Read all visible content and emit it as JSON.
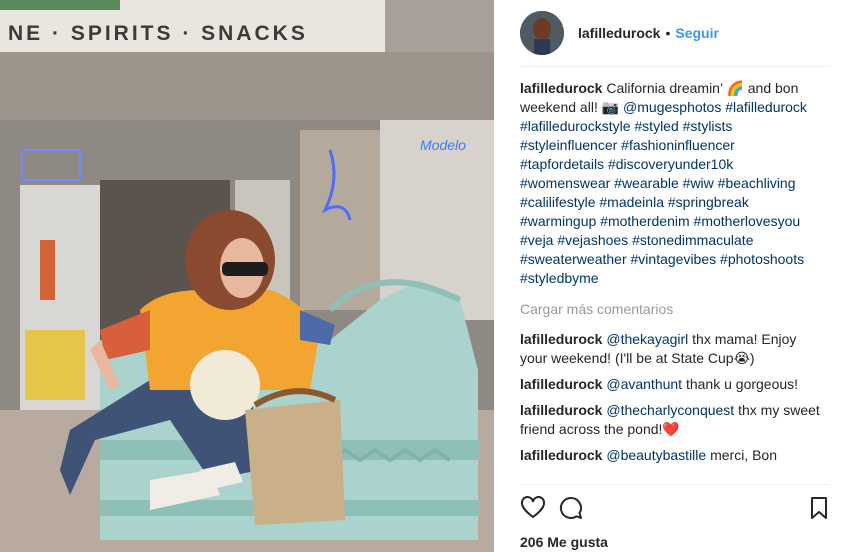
{
  "photo": {
    "sign_text": "NE · SPIRITS · SNACKS",
    "neon_text": "Modelo"
  },
  "header": {
    "username": "lafilledurock",
    "separator": "•",
    "follow_label": "Seguir"
  },
  "caption": {
    "username": "lafilledurock",
    "text_parts": [
      {
        "type": "text",
        "value": " California dreamin’ 🌈 and bon weekend all! 📷 "
      },
      {
        "type": "tag",
        "value": "@mugesphotos"
      },
      {
        "type": "text",
        "value": " "
      },
      {
        "type": "tag",
        "value": "#lafilledurock"
      },
      {
        "type": "text",
        "value": " "
      },
      {
        "type": "tag",
        "value": "#lafilledurockstyle"
      },
      {
        "type": "text",
        "value": " "
      },
      {
        "type": "tag",
        "value": "#styled"
      },
      {
        "type": "text",
        "value": " "
      },
      {
        "type": "tag",
        "value": "#stylists"
      },
      {
        "type": "text",
        "value": " "
      },
      {
        "type": "tag",
        "value": "#styleinfluencer"
      },
      {
        "type": "text",
        "value": " "
      },
      {
        "type": "tag",
        "value": "#fashioninfluencer"
      },
      {
        "type": "text",
        "value": " "
      },
      {
        "type": "tag",
        "value": "#tapfordetails"
      },
      {
        "type": "text",
        "value": " "
      },
      {
        "type": "tag",
        "value": "#discoveryunder10k"
      },
      {
        "type": "text",
        "value": " "
      },
      {
        "type": "tag",
        "value": "#womenswear"
      },
      {
        "type": "text",
        "value": " "
      },
      {
        "type": "tag",
        "value": "#wearable"
      },
      {
        "type": "text",
        "value": " "
      },
      {
        "type": "tag",
        "value": "#wiw"
      },
      {
        "type": "text",
        "value": " "
      },
      {
        "type": "tag",
        "value": "#beachliving"
      },
      {
        "type": "text",
        "value": " "
      },
      {
        "type": "tag",
        "value": "#calilifestyle"
      },
      {
        "type": "text",
        "value": " "
      },
      {
        "type": "tag",
        "value": "#madeinla"
      },
      {
        "type": "text",
        "value": " "
      },
      {
        "type": "tag",
        "value": "#springbreak"
      },
      {
        "type": "text",
        "value": " "
      },
      {
        "type": "tag",
        "value": "#warmingup"
      },
      {
        "type": "text",
        "value": " "
      },
      {
        "type": "tag",
        "value": "#motherdenim"
      },
      {
        "type": "text",
        "value": " "
      },
      {
        "type": "tag",
        "value": "#motherlovesyou"
      },
      {
        "type": "text",
        "value": " "
      },
      {
        "type": "tag",
        "value": "#veja"
      },
      {
        "type": "text",
        "value": " "
      },
      {
        "type": "tag",
        "value": "#vejashoes"
      },
      {
        "type": "text",
        "value": " "
      },
      {
        "type": "tag",
        "value": "#stonedimmaculate"
      },
      {
        "type": "text",
        "value": " "
      },
      {
        "type": "tag",
        "value": "#sweaterweather"
      },
      {
        "type": "text",
        "value": " "
      },
      {
        "type": "tag",
        "value": "#vintagevibes"
      },
      {
        "type": "text",
        "value": " "
      },
      {
        "type": "tag",
        "value": "#photoshoots"
      },
      {
        "type": "text",
        "value": " "
      },
      {
        "type": "tag",
        "value": "#styledbyme"
      }
    ]
  },
  "load_more_label": "Cargar más comentarios",
  "comments": [
    {
      "username": "lafilledurock",
      "mention": "@thekayagirl",
      "text": " thx mama! Enjoy your weekend! (I'll be at State Cup😭)"
    },
    {
      "username": "lafilledurock",
      "mention": "@avanthunt",
      "text": " thank u gorgeous!"
    },
    {
      "username": "lafilledurock",
      "mention": "@thecharlyconquest",
      "text": " thx my sweet friend across the pond!❤️"
    },
    {
      "username": "lafilledurock",
      "mention": "@beautybastille",
      "text": " merci, Bon"
    }
  ],
  "actions": {
    "like_icon": "heart-icon",
    "comment_icon": "comment-icon",
    "save_icon": "bookmark-icon",
    "likes_text": "206 Me gusta"
  },
  "colors": {
    "link": "#003569",
    "follow": "#3897f0",
    "muted": "#999999",
    "bench": "#a9d3cc"
  }
}
